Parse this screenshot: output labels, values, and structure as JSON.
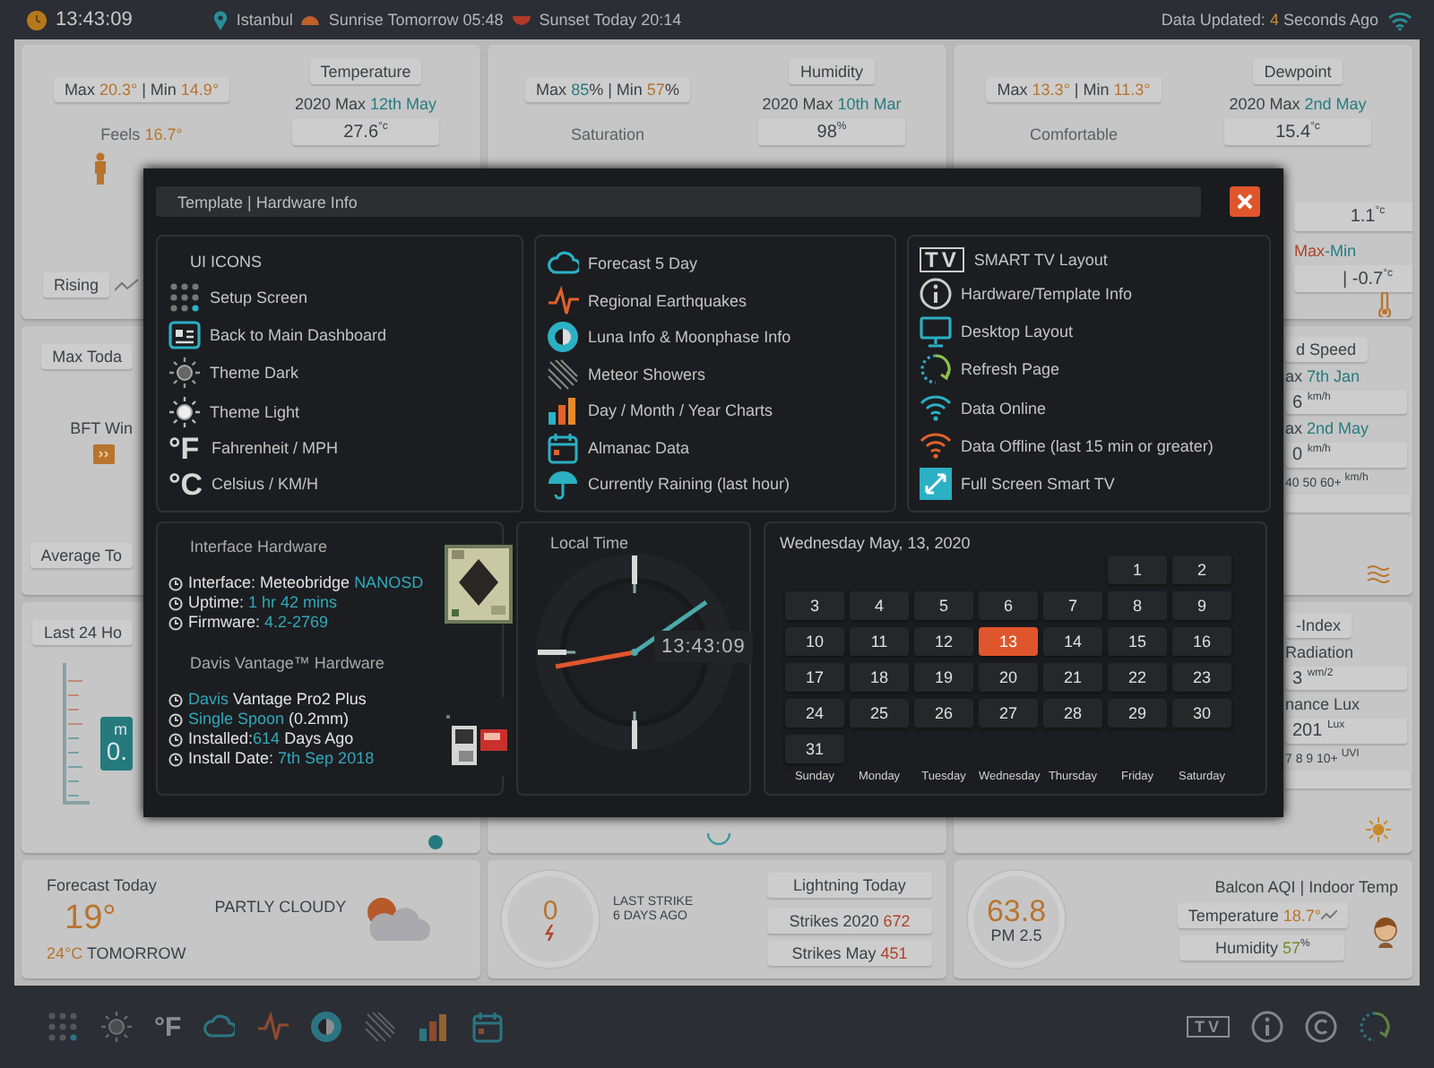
{
  "top_bar": {
    "time": "13:43:09",
    "location": "Istanbul",
    "sunrise": "Sunrise Tomorrow 05:48",
    "sunset": "Sunset Today 20:14",
    "updated": [
      {
        "text": "Data Updated: "
      },
      {
        "text": "4",
        "color": "#c98a2e"
      },
      {
        "text": " Seconds Ago"
      }
    ]
  },
  "summary_cards": [
    {
      "range": [
        {
          "text": "Max "
        },
        {
          "text": "20.3°",
          "color": "#b8742e"
        },
        {
          "text": " | Min "
        },
        {
          "text": "14.9°",
          "color": "#b8742e"
        }
      ],
      "title": "Temperature",
      "label": [
        {
          "text": "Feels "
        },
        {
          "text": "16.7°",
          "color": "#b8742e"
        }
      ],
      "record_max": [
        {
          "text": "2020 Max "
        },
        {
          "text": "12th May",
          "color": "#277c80"
        }
      ],
      "record_max_value": [
        {
          "text": "27.6"
        },
        {
          "text": "°c",
          "kind": "unit"
        }
      ],
      "trend": "Rising"
    },
    {
      "range": [
        {
          "text": "Max "
        },
        {
          "text": "85",
          "color": "#277c80"
        },
        {
          "text": "% | Min "
        },
        {
          "text": "57",
          "color": "#b8742e"
        },
        {
          "text": "%"
        }
      ],
      "title": "Humidity",
      "label": [
        {
          "text": "Saturation"
        }
      ],
      "record_max": [
        {
          "text": "2020 Max "
        },
        {
          "text": "10th Mar",
          "color": "#277c80"
        }
      ],
      "record_max_value": [
        {
          "text": "98"
        },
        {
          "text": "%",
          "kind": "unit"
        }
      ]
    },
    {
      "range": [
        {
          "text": "Max "
        },
        {
          "text": "13.3°",
          "color": "#b8742e"
        },
        {
          "text": " | Min "
        },
        {
          "text": "11.3°",
          "color": "#b8742e"
        }
      ],
      "title": "Dewpoint",
      "label": [
        {
          "text": "Comfortable"
        }
      ],
      "record_max": [
        {
          "text": "2020 Max "
        },
        {
          "text": "2nd May",
          "color": "#277c80"
        }
      ],
      "record_max_value": [
        {
          "text": "15.4"
        },
        {
          "text": "°c",
          "kind": "unit"
        }
      ],
      "record_min_value": [
        {
          "text": "1.1"
        },
        {
          "text": "°c",
          "kind": "unit"
        }
      ],
      "spread_label": [
        {
          "text": "Max",
          "color": "#b0432c"
        },
        {
          "text": "-Min",
          "color": "#277c80"
        }
      ],
      "spread_value": [
        {
          "text": "| -0.7"
        },
        {
          "text": "°c",
          "kind": "unit"
        }
      ]
    }
  ],
  "wind_card": {
    "title": "Max Toda",
    "label": "BFT Win",
    "footer": "Average To"
  },
  "wind_speed_card": {
    "title": "d Speed",
    "rows": [
      {
        "kind": "label",
        "parts": [
          {
            "text": "ax "
          },
          {
            "text": "7th Jan",
            "color": "#277c80"
          }
        ]
      },
      {
        "kind": "value",
        "parts": [
          {
            "text": "6 "
          },
          {
            "text": "km/h",
            "kind": "unit"
          }
        ]
      },
      {
        "kind": "label",
        "parts": [
          {
            "text": "ax "
          },
          {
            "text": "2nd May",
            "color": "#277c80"
          }
        ]
      },
      {
        "kind": "value",
        "parts": [
          {
            "text": "0 "
          },
          {
            "text": "km/h",
            "kind": "unit"
          }
        ]
      },
      {
        "kind": "scale",
        "parts": [
          {
            "text": "40 50 60+ "
          },
          {
            "text": "km/h",
            "kind": "unit"
          }
        ]
      }
    ]
  },
  "rain_card": {
    "title": "Last 24 Ho",
    "box_label": "m",
    "box_value": "0."
  },
  "uv_card": {
    "title": "-Index",
    "rows": [
      {
        "kind": "label",
        "parts": [
          {
            "text": "Radiation"
          }
        ]
      },
      {
        "kind": "value",
        "parts": [
          {
            "text": "3 "
          },
          {
            "text": "wm/2",
            "kind": "unit"
          }
        ]
      },
      {
        "kind": "label",
        "parts": [
          {
            "text": "nance Lux"
          }
        ]
      },
      {
        "kind": "value",
        "parts": [
          {
            "text": "201 "
          },
          {
            "text": "Lux",
            "kind": "unit"
          }
        ]
      },
      {
        "kind": "scale",
        "parts": [
          {
            "text": "7 8 9 10+ "
          },
          {
            "text": "UVI",
            "kind": "unit"
          }
        ]
      }
    ]
  },
  "forecast_card": {
    "title": "Forecast Today",
    "temperature": "19°",
    "tomorrow": [
      {
        "text": "24°C",
        "color": "#b8742e"
      },
      {
        "text": " TOMORROW"
      }
    ],
    "condition": "PARTLY CLOUDY"
  },
  "lightning_card": {
    "count": "0",
    "last_strike": "LAST STRIKE",
    "last_strike_age": "6 DAYS AGO",
    "title": "Lightning Today",
    "rows": [
      [
        {
          "text": "Strikes 2020 "
        },
        {
          "text": "672",
          "color": "#b0432c"
        }
      ],
      [
        {
          "text": "Strikes May "
        },
        {
          "text": "451",
          "color": "#b0432c"
        }
      ]
    ]
  },
  "air_card": {
    "value": "63.8",
    "unit": "PM 2.5",
    "title": "Balcon AQI | Indoor Temp",
    "rows": [
      [
        {
          "text": "Temperature "
        },
        {
          "text": "18.7°",
          "color": "#b8742e"
        }
      ],
      [
        {
          "text": "Humidity "
        },
        {
          "text": "57",
          "color": "#6d8e2e"
        },
        {
          "text": "%",
          "kind": "unit"
        }
      ]
    ]
  },
  "toolbar": {
    "fahrenheit": "°F",
    "tv": "TV"
  },
  "modal": {
    "title": "Template | Hardware Info",
    "panels": [
      {
        "title": "UI ICONS",
        "items": [
          {
            "label": "Setup Screen"
          },
          {
            "label": "Back to Main Dashboard"
          },
          {
            "label": "Theme Dark"
          },
          {
            "label": "Theme Light"
          },
          {
            "glyph": "°F",
            "label": "Fahrenheit / MPH"
          },
          {
            "glyph": "°C",
            "label": "Celsius / KM/H"
          }
        ]
      },
      {
        "items": [
          {
            "label": "Forecast 5 Day"
          },
          {
            "label": "Regional Earthquakes"
          },
          {
            "label": "Luna Info & Moonphase Info"
          },
          {
            "label": "Meteor Showers"
          },
          {
            "label": "Day / Month / Year Charts"
          },
          {
            "label": "Almanac Data"
          },
          {
            "label": "Currently Raining (last hour)"
          }
        ]
      },
      {
        "items": [
          {
            "glyph": "TV",
            "label": "SMART TV Layout"
          },
          {
            "label": "Hardware/Template Info"
          },
          {
            "label": "Desktop Layout"
          },
          {
            "label": "Refresh Page"
          },
          {
            "label": "Data Online"
          },
          {
            "label": "Data Offline (last 15 min or greater)"
          },
          {
            "label": "Full Screen Smart TV"
          }
        ]
      }
    ],
    "hardware": {
      "title": "Interface Hardware",
      "lines": [
        [
          {
            "text": "Interface: Meteobridge "
          },
          {
            "text": "NANOSD",
            "color": "#2fa9bb"
          }
        ],
        [
          {
            "text": "Uptime: "
          },
          {
            "text": "1 hr 42 mins",
            "color": "#2fa9bb"
          }
        ],
        [
          {
            "text": "Firmware: "
          },
          {
            "text": "4.2-2769",
            "color": "#2fa9bb"
          }
        ]
      ],
      "station_title": "Davis Vantage™ Hardware",
      "station_lines": [
        [
          {
            "text": "Davis",
            "color": "#2fa9bb"
          },
          {
            "text": " Vantage Pro2 Plus"
          }
        ],
        [
          {
            "text": "Single Spoon",
            "color": "#2fa9bb"
          },
          {
            "text": " (0.2mm)"
          }
        ],
        [
          {
            "text": "Installed:"
          },
          {
            "text": "614",
            "color": "#2fa9bb"
          },
          {
            "text": " Days Ago"
          }
        ],
        [
          {
            "text": "Install Date: "
          },
          {
            "text": "7th Sep 2018",
            "color": "#2fa9bb"
          }
        ]
      ]
    },
    "clock": {
      "title": "Local Time",
      "time": "13:43:09"
    },
    "calendar": {
      "title": "Wednesday May, 13, 2020",
      "weeks": [
        [
          {
            "kind": "blank"
          },
          {
            "kind": "blank"
          },
          {
            "kind": "blank"
          },
          {
            "kind": "blank"
          },
          {
            "kind": "blank"
          },
          {
            "kind": "day",
            "day": "1",
            "selected": false
          },
          {
            "kind": "day",
            "day": "2",
            "selected": false
          }
        ],
        [
          {
            "kind": "day",
            "day": "3",
            "selected": false
          },
          {
            "kind": "day",
            "day": "4",
            "selected": false
          },
          {
            "kind": "day",
            "day": "5",
            "selected": false
          },
          {
            "kind": "day",
            "day": "6",
            "selected": false
          },
          {
            "kind": "day",
            "day": "7",
            "selected": false
          },
          {
            "kind": "day",
            "day": "8",
            "selected": false
          },
          {
            "kind": "day",
            "day": "9",
            "selected": false
          }
        ],
        [
          {
            "kind": "day",
            "day": "10",
            "selected": false
          },
          {
            "kind": "day",
            "day": "11",
            "selected": false
          },
          {
            "kind": "day",
            "day": "12",
            "selected": false
          },
          {
            "kind": "day",
            "day": "13",
            "selected": true
          },
          {
            "kind": "day",
            "day": "14",
            "selected": false
          },
          {
            "kind": "day",
            "day": "15",
            "selected": false
          },
          {
            "kind": "day",
            "day": "16",
            "selected": false
          }
        ],
        [
          {
            "kind": "day",
            "day": "17",
            "selected": false
          },
          {
            "kind": "day",
            "day": "18",
            "selected": false
          },
          {
            "kind": "day",
            "day": "19",
            "selected": false
          },
          {
            "kind": "day",
            "day": "20",
            "selected": false
          },
          {
            "kind": "day",
            "day": "21",
            "selected": false
          },
          {
            "kind": "day",
            "day": "22",
            "selected": false
          },
          {
            "kind": "day",
            "day": "23",
            "selected": false
          }
        ],
        [
          {
            "kind": "day",
            "day": "24",
            "selected": false
          },
          {
            "kind": "day",
            "day": "25",
            "selected": false
          },
          {
            "kind": "day",
            "day": "26",
            "selected": false
          },
          {
            "kind": "day",
            "day": "27",
            "selected": false
          },
          {
            "kind": "day",
            "day": "28",
            "selected": false
          },
          {
            "kind": "day",
            "day": "29",
            "selected": false
          },
          {
            "kind": "day",
            "day": "30",
            "selected": false
          }
        ],
        [
          {
            "kind": "day",
            "day": "31",
            "selected": false
          }
        ]
      ],
      "weekdays": [
        "Sunday",
        "Monday",
        "Tuesday",
        "Wednesday",
        "Thursday",
        "Friday",
        "Saturday"
      ]
    }
  }
}
